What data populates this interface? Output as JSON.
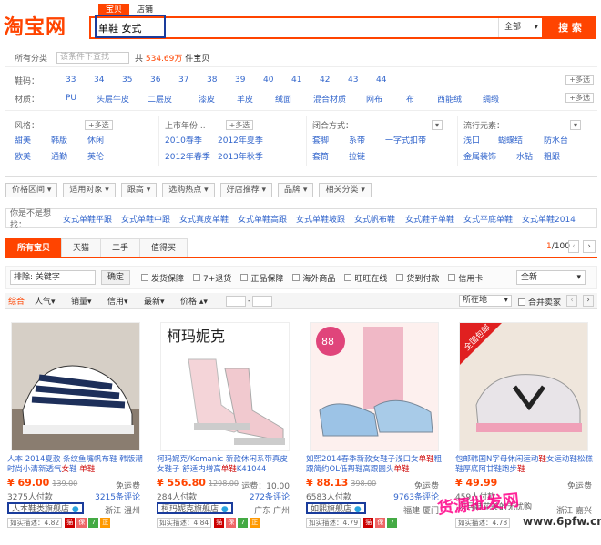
{
  "header": {
    "logo": "淘宝网",
    "tabs": [
      "宝贝",
      "店铺"
    ],
    "query": "单鞋 女式",
    "scope": "全部",
    "search_btn": "搜 索"
  },
  "top": {
    "all_cat": "所有分类",
    "search_in_placeholder": "该条件下查找",
    "count_prefix": "共",
    "count": "534.69万",
    "count_suffix": "件宝贝"
  },
  "attrs": {
    "size_label": "鞋码：",
    "sizes": [
      "33",
      "34",
      "35",
      "36",
      "37",
      "38",
      "39",
      "40",
      "41",
      "42",
      "43",
      "44"
    ],
    "material_label": "材质：",
    "materials": [
      "PU",
      "头层牛皮",
      "二层皮",
      "漆皮",
      "羊皮",
      "绒面",
      "混合材质",
      "网布",
      "布",
      "西能绒",
      "绸缎"
    ],
    "more": "+多选"
  },
  "groups": {
    "style": {
      "label": "风格：",
      "items": [
        "甜美",
        "韩版",
        "休闲",
        "欧美",
        "通勤",
        "英伦"
      ]
    },
    "season": {
      "label": "上市年份...",
      "items": [
        "2010春季",
        "2012年夏季",
        "2012年春季",
        "2013年秋季"
      ]
    },
    "closure": {
      "label": "闭合方式：",
      "items": [
        "套脚",
        "系带",
        "一字式扣带",
        "套筒",
        "拉链"
      ]
    },
    "trend": {
      "label": "流行元素：",
      "items": [
        "浅口",
        "蝴蝶结",
        "防水台",
        "金属装饰",
        "水钻",
        "粗跟"
      ]
    },
    "more": "+多选"
  },
  "selbar": [
    "价格区间",
    "适用对象",
    "跟高",
    "选购热点",
    "好店推荐",
    "品牌",
    "相关分类"
  ],
  "think": {
    "label": "你是不是想找：",
    "items": [
      "女式单鞋平跟",
      "女式单鞋中跟",
      "女式真皮单鞋",
      "女式单鞋高跟",
      "女式单鞋坡跟",
      "女式帆布鞋",
      "女式鞋子单鞋",
      "女式平底单鞋",
      "女式单鞋2014"
    ]
  },
  "tabs": {
    "items": [
      "所有宝贝",
      "天猫",
      "二手",
      "值得买"
    ],
    "page": "1",
    "pages": "/100"
  },
  "filter": {
    "keyword_label": "排除:",
    "keyword_ph": "关键字",
    "ok": "确定",
    "checks": [
      "发货保障",
      "7+退货",
      "正品保障",
      "海外商品",
      "旺旺在线",
      "货到付款",
      "信用卡"
    ],
    "sort_all": "全新"
  },
  "sort": {
    "items": [
      "综合",
      "人气",
      "销量",
      "信用",
      "最新",
      "价格"
    ],
    "location": "所在地",
    "combine": "合并卖家"
  },
  "products": [
    {
      "title_a": "人本 2014夏款 条纹鱼嘴帆布鞋 韩版潮 时尚小清新透气",
      "title_hi": "女",
      "title_b": "鞋",
      "title_hi2": "单鞋",
      "price": "¥ 69.00",
      "old": "139.00",
      "freight": "免运费",
      "sold": "3275人付款",
      "reviews": "3215条评论",
      "shop": "人本鞋类旗舰店",
      "loc": "浙江 温州",
      "rating": "如实描述：4.82"
    },
    {
      "title_a": "柯玛妮克/Komanic 新款休闲系带真皮女鞋子 舒适内增高",
      "title_hi": "单鞋",
      "title_b": "K41044",
      "title_hi2": "",
      "price": "¥ 556.80",
      "old": "1298.00",
      "freight": "运费：10.00",
      "sold": "284人付款",
      "reviews": "272条评论",
      "shop": "柯玛妮克旗舰店",
      "loc": "广东 广州",
      "rating": "如实描述：4.84"
    },
    {
      "title_a": "如熙2014春季新款女鞋子浅口女",
      "title_hi": "单鞋",
      "title_b": "粗跟简约OL低帮鞋高跟圆头",
      "title_hi2": "单鞋",
      "price": "¥ 88.13",
      "old": "398.00",
      "freight": "免运费",
      "sold": "6583人付款",
      "reviews": "9763条评论",
      "shop": "如熙旗舰店",
      "loc": "福建 厦门",
      "rating": "如实描述：4.79"
    },
    {
      "title_a": "包邮韩国N字母休闲运动",
      "title_hi": "鞋",
      "title_b": "女运动鞋松糕鞋厚底阿甘鞋跑步",
      "title_hi2": "鞋",
      "price": "¥ 49.99",
      "old": "",
      "freight": "免运费",
      "sold": "459人付款",
      "reviews": "",
      "shop": "闪月鞋花美的无忧购",
      "loc": "浙江 嘉兴",
      "rating": "如实描述：4.78"
    }
  ],
  "watermark": {
    "text": "货源批发网",
    "site": "www.6pfw.cn"
  }
}
